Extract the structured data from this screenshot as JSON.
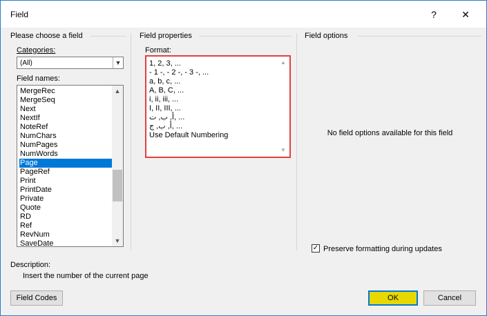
{
  "window": {
    "title": "Field",
    "help_label": "?",
    "close_label": "✕"
  },
  "left": {
    "heading": "Please choose a field",
    "categories_label": "Categories:",
    "categories_value": "(All)",
    "field_names_label": "Field names:",
    "field_names": [
      "MergeRec",
      "MergeSeq",
      "Next",
      "NextIf",
      "NoteRef",
      "NumChars",
      "NumPages",
      "NumWords",
      "Page",
      "PageRef",
      "Print",
      "PrintDate",
      "Private",
      "Quote",
      "RD",
      "Ref",
      "RevNum",
      "SaveDate"
    ],
    "selected": "Page"
  },
  "middle": {
    "heading": "Field properties",
    "format_label": "Format:",
    "formats": [
      "1, 2, 3, ...",
      "- 1 -, - 2 -, - 3 -, ...",
      "a, b, c, ...",
      "A, B, C, ...",
      "i, ii, iii, ...",
      "I, II, III, ...",
      "أ, ب, ت, ...",
      "أ, ب, ج, ...",
      "Use Default Numbering"
    ]
  },
  "right": {
    "heading": "Field options",
    "no_options_text": "No field options available for this field",
    "preserve_label": "Preserve formatting during updates",
    "preserve_checked": true
  },
  "description": {
    "label": "Description:",
    "text": "Insert the number of the current page"
  },
  "buttons": {
    "field_codes": "Field Codes",
    "ok": "OK",
    "cancel": "Cancel"
  },
  "colors": {
    "ok_button_bg": "#e6d800",
    "highlight_border": "#e04040",
    "selection": "#0078d7"
  }
}
